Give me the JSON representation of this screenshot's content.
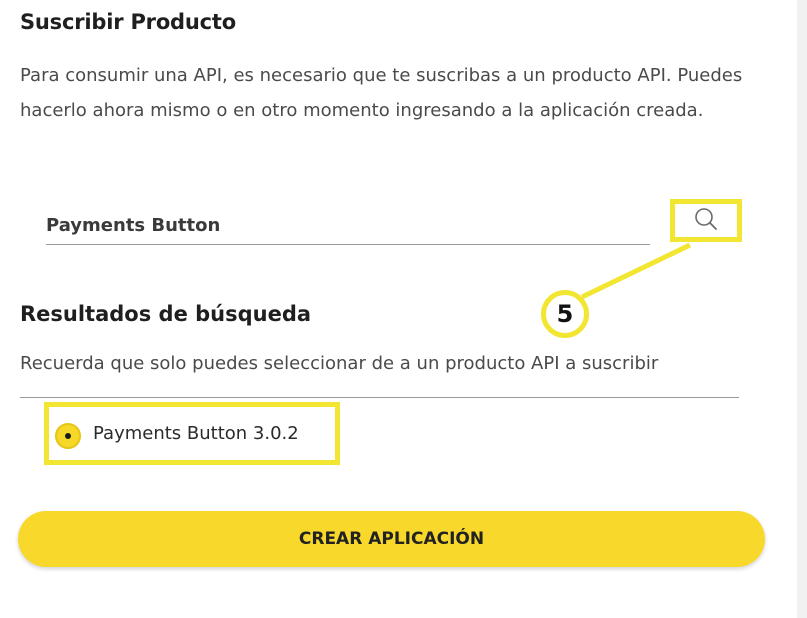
{
  "subscribe": {
    "title": "Suscribir Producto",
    "description": "Para consumir una API, es necesario que te suscribas a un producto API. Puedes hacerlo ahora mismo o en otro momento ingresando a la aplicación creada."
  },
  "search": {
    "value": "Payments Button",
    "icon": "search-icon"
  },
  "callout": {
    "step_number": "5",
    "highlight_color": "#f2e633"
  },
  "results": {
    "title": "Resultados de búsqueda",
    "hint": "Recuerda que solo puedes seleccionar de a un producto API a suscribir",
    "items": [
      {
        "label": "Payments Button 3.0.2",
        "selected": true
      }
    ]
  },
  "actions": {
    "create_label": "CREAR APLICACIÓN",
    "button_color": "#f8d82b"
  }
}
